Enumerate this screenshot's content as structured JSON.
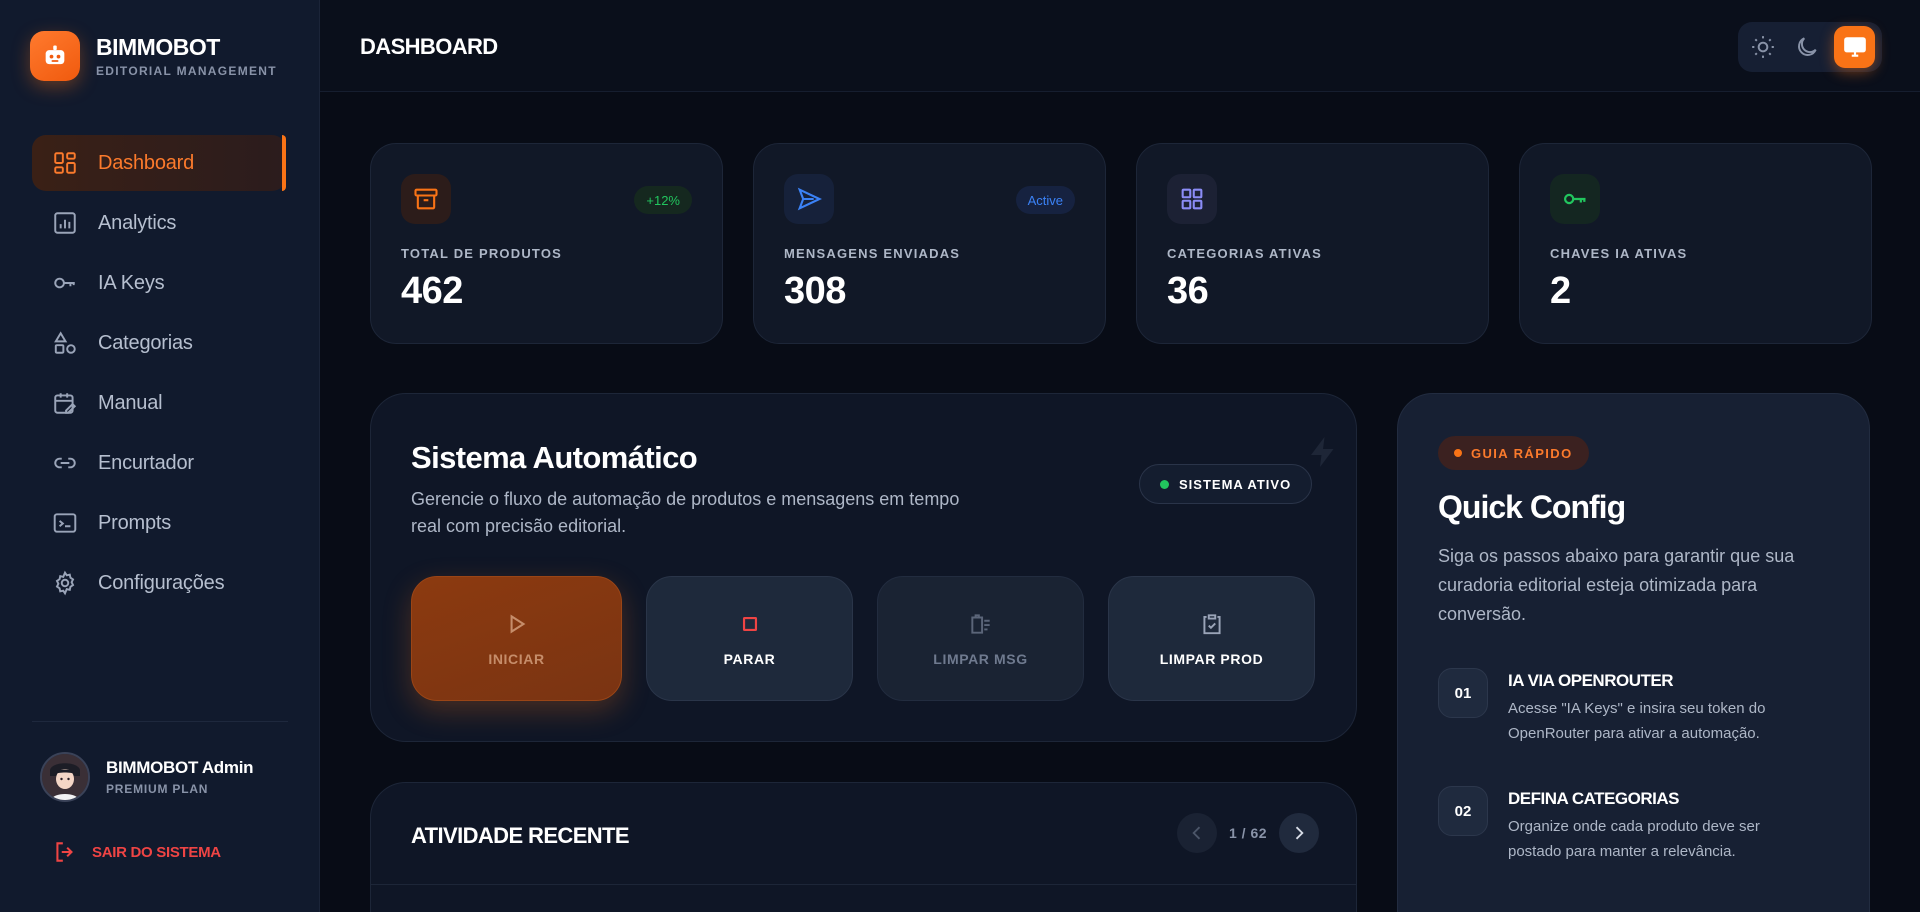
{
  "brand": {
    "name": "BIMMOBOT",
    "subtitle": "EDITORIAL MANAGEMENT",
    "logo_icon": "robot-icon",
    "accent": "#f97316"
  },
  "sidebar": {
    "items": [
      {
        "label": "Dashboard",
        "icon": "dashboard-icon",
        "active": true
      },
      {
        "label": "Analytics",
        "icon": "analytics-icon"
      },
      {
        "label": "IA Keys",
        "icon": "key-icon"
      },
      {
        "label": "Categorias",
        "icon": "shapes-icon"
      },
      {
        "label": "Manual",
        "icon": "calendar-edit-icon"
      },
      {
        "label": "Encurtador",
        "icon": "link-icon"
      },
      {
        "label": "Prompts",
        "icon": "terminal-icon"
      },
      {
        "label": "Configurações",
        "icon": "gear-icon"
      }
    ]
  },
  "user": {
    "name": "BIMMOBOT Admin",
    "plan": "PREMIUM PLAN",
    "logout_label": "SAIR DO SISTEMA"
  },
  "header": {
    "title": "DASHBOARD",
    "theme_options": [
      "light",
      "dark",
      "system"
    ],
    "theme_selected": "system"
  },
  "stats": [
    {
      "label": "TOTAL DE PRODUTOS",
      "value": "462",
      "badge": "+12%",
      "icon": "archive-icon",
      "color": "#f97316",
      "badge_color": "#22c55e"
    },
    {
      "label": "MENSAGENS ENVIADAS",
      "value": "308",
      "badge": "Active",
      "icon": "send-icon",
      "color": "#3b82f6",
      "badge_color": "#3b82f6"
    },
    {
      "label": "CATEGORIAS ATIVAS",
      "value": "36",
      "badge": "",
      "icon": "grid-icon",
      "color": "#8b8cf6"
    },
    {
      "label": "CHAVES IA ATIVAS",
      "value": "2",
      "badge": "",
      "icon": "key-icon",
      "color": "#22c55e"
    }
  ],
  "automation": {
    "title": "Sistema Automático",
    "description": "Gerencie o fluxo de automação de produtos e mensagens em tempo real com precisão editorial.",
    "status": "SISTEMA ATIVO",
    "status_color": "#22c55e",
    "actions": [
      {
        "label": "INICIAR",
        "icon": "play-icon"
      },
      {
        "label": "PARAR",
        "icon": "stop-icon"
      },
      {
        "label": "LIMPAR MSG",
        "icon": "clear-messages-icon"
      },
      {
        "label": "LIMPAR PROD",
        "icon": "clipboard-check-icon"
      }
    ]
  },
  "recent": {
    "title": "ATIVIDADE RECENTE",
    "page_info": "1 / 62"
  },
  "quick": {
    "tag": "GUIA RÁPIDO",
    "title": "Quick Config",
    "description": "Siga os passos abaixo para garantir que sua curadoria editorial esteja otimizada para conversão.",
    "steps": [
      {
        "num": "01",
        "title": "IA VIA OPENROUTER",
        "text": "Acesse \"IA Keys\" e insira seu token do OpenRouter para ativar a automação."
      },
      {
        "num": "02",
        "title": "DEFINA CATEGORIAS",
        "text": "Organize onde cada produto deve ser postado para manter a relevância."
      }
    ]
  }
}
